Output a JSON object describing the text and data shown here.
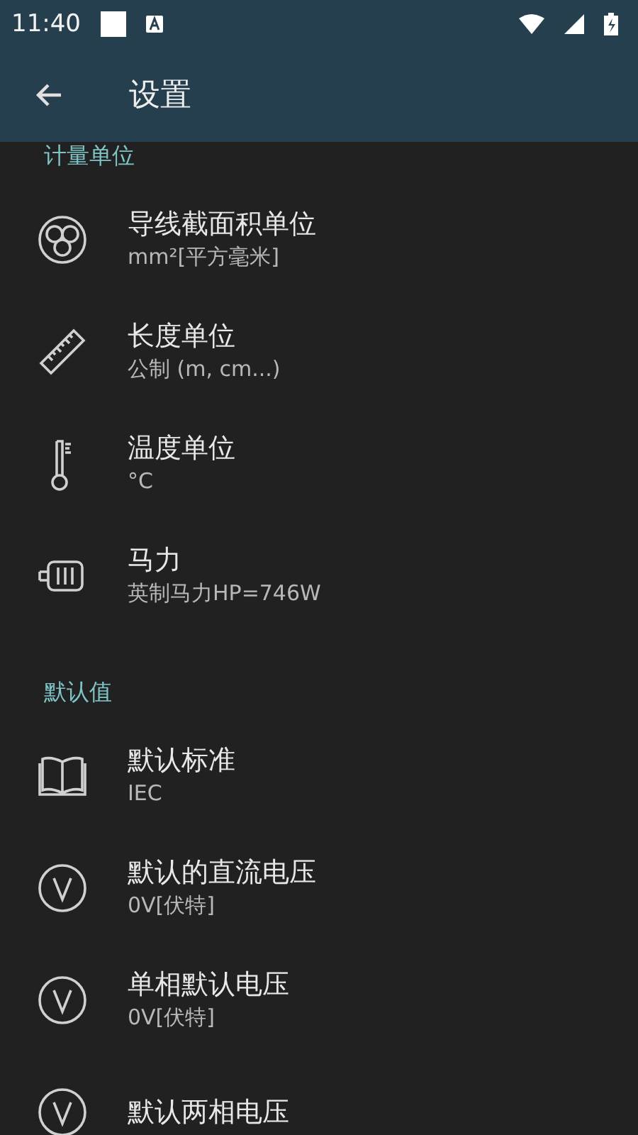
{
  "status_bar": {
    "time": "11:40"
  },
  "toolbar": {
    "title": "设置"
  },
  "sections": [
    {
      "header": "计量单位",
      "items": [
        {
          "title": "导线截面积单位",
          "value": "mm²[平方毫米]"
        },
        {
          "title": "长度单位",
          "value": "公制 (m, cm...)"
        },
        {
          "title": "温度单位",
          "value": "°C"
        },
        {
          "title": "马力",
          "value": "英制马力HP=746W"
        }
      ]
    },
    {
      "header": "默认值",
      "items": [
        {
          "title": "默认标准",
          "value": "IEC"
        },
        {
          "title": "默认的直流电压",
          "value": "0V[伏特]"
        },
        {
          "title": "单相默认电压",
          "value": "0V[伏特]"
        },
        {
          "title": "默认两相电压"
        }
      ]
    }
  ]
}
